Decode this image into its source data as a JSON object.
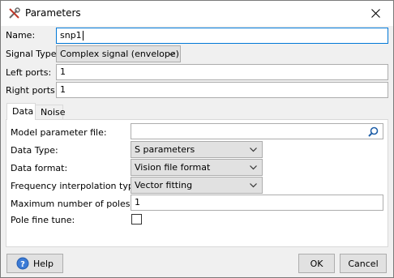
{
  "window": {
    "title": "Parameters",
    "icon": "tools-icon"
  },
  "fields": {
    "name": {
      "label": "Name:",
      "value": "snp1"
    },
    "signal_type": {
      "label": "Signal Type:",
      "value": "Complex signal (envelope)"
    },
    "left_ports": {
      "label": "Left ports:",
      "value": "1"
    },
    "right_ports": {
      "label": "Right ports:",
      "value": "1"
    }
  },
  "tabs": [
    {
      "label": "Data",
      "active": true
    },
    {
      "label": "Noise",
      "active": false
    }
  ],
  "data_tab": {
    "model_parameter_file": {
      "label": "Model parameter file:",
      "value": ""
    },
    "data_type": {
      "label": "Data Type:",
      "value": "S parameters"
    },
    "data_format": {
      "label": "Data format:",
      "value": "Vision file format"
    },
    "frequency_interpolation_type": {
      "label": "Frequency interpolation type:",
      "value": "Vector fitting"
    },
    "maximum_number_of_poles": {
      "label": "Maximum number of poles:",
      "value": "1"
    },
    "pole_fine_tune": {
      "label": "Pole fine tune:",
      "checked": false
    }
  },
  "buttons": {
    "help": "Help",
    "ok": "OK",
    "cancel": "Cancel"
  },
  "colors": {
    "accent": "#0078d7",
    "help_icon": "#2a62b5"
  }
}
